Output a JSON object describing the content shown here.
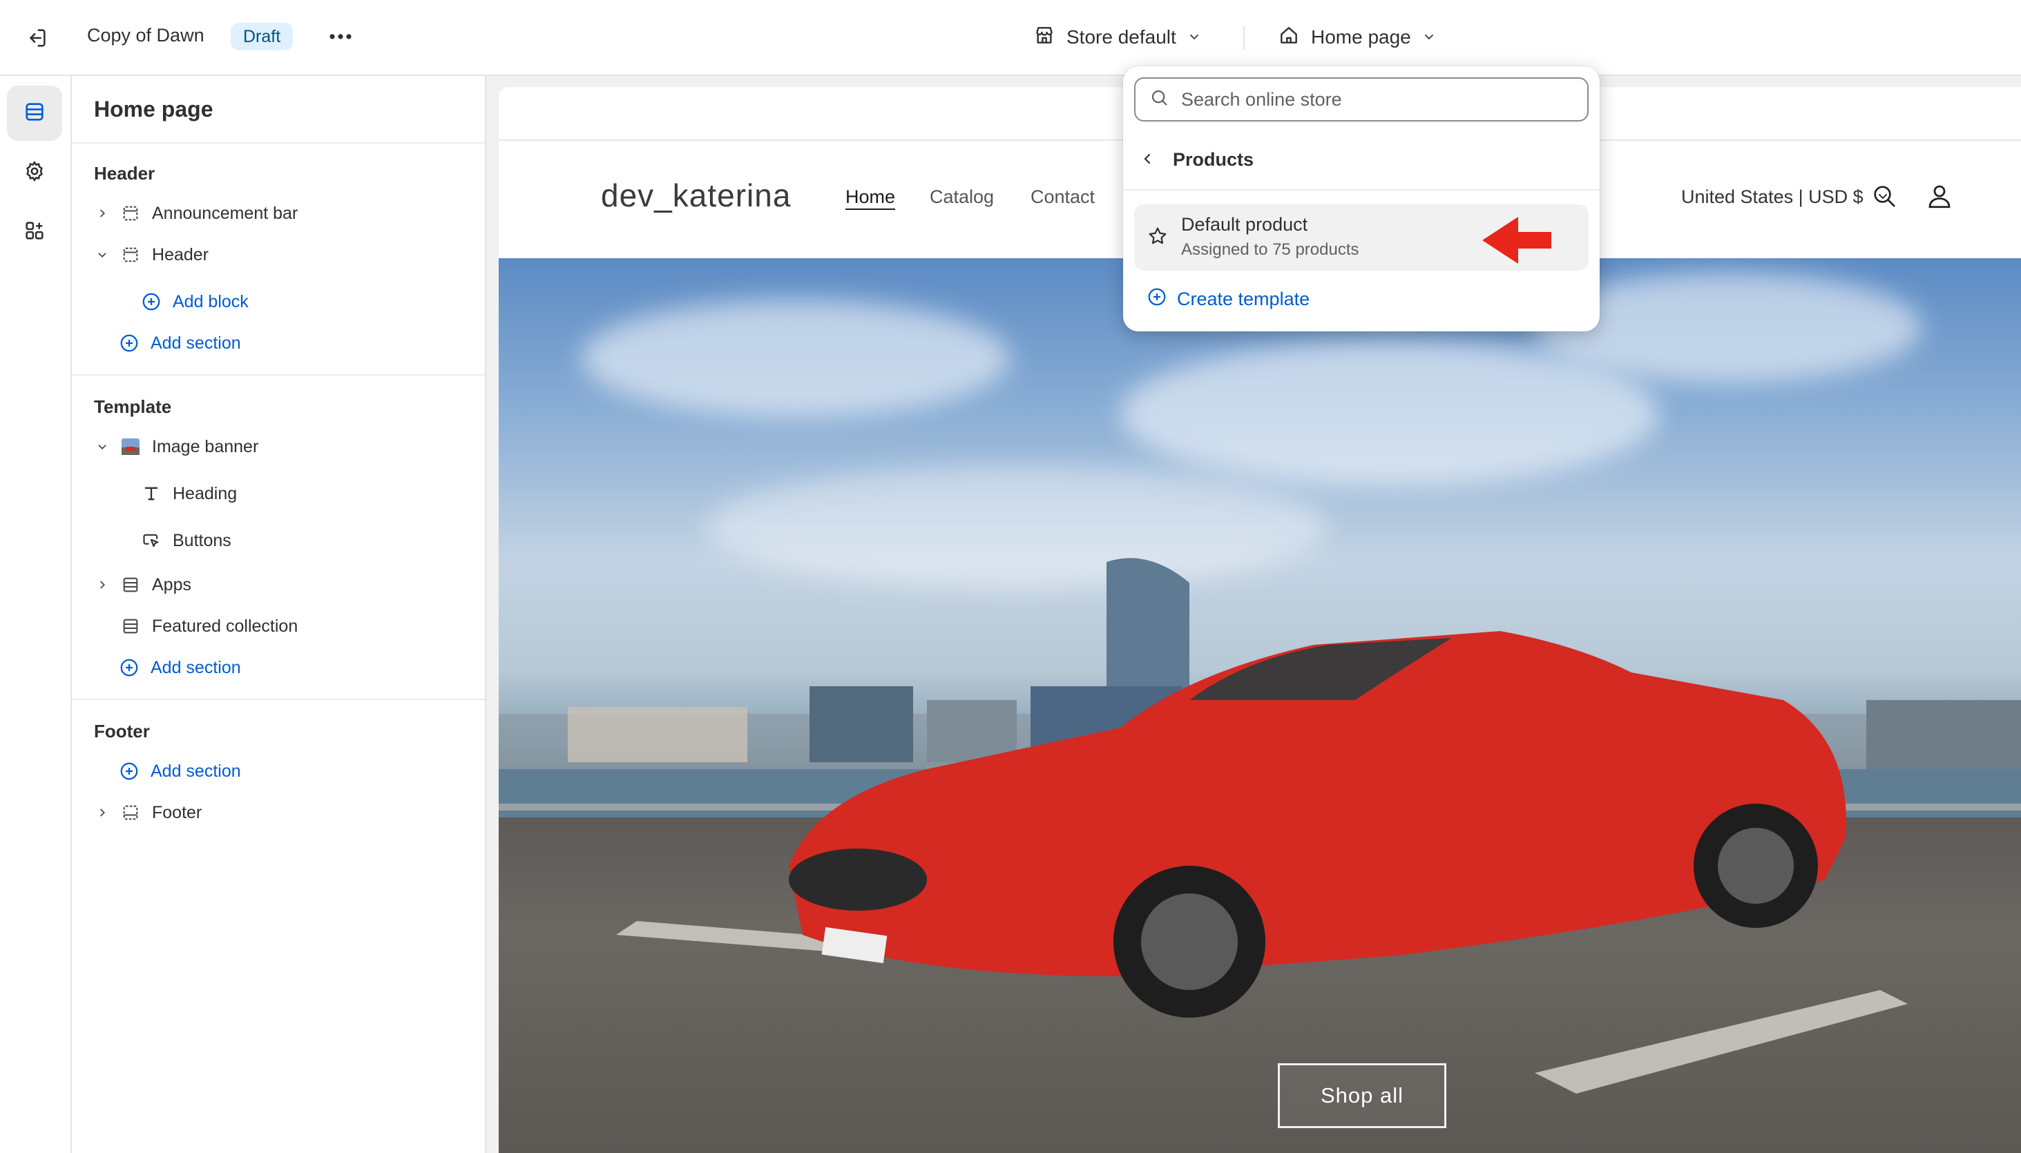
{
  "topbar": {
    "theme_name": "Copy of Dawn",
    "badge": "Draft",
    "store_context": "Store default",
    "page_context": "Home page"
  },
  "sidebar": {
    "title": "Home page",
    "header_group": {
      "title": "Header",
      "items": [
        {
          "label": "Announcement bar"
        },
        {
          "label": "Header"
        },
        {
          "label": "Add block"
        },
        {
          "label": "Add section"
        }
      ]
    },
    "template_group": {
      "title": "Template",
      "items": [
        {
          "label": "Image banner"
        },
        {
          "label": "Heading"
        },
        {
          "label": "Buttons"
        },
        {
          "label": "Apps"
        },
        {
          "label": "Featured collection"
        },
        {
          "label": "Add section"
        }
      ]
    },
    "footer_group": {
      "title": "Footer",
      "items": [
        {
          "label": "Add section"
        },
        {
          "label": "Footer"
        }
      ]
    }
  },
  "preview": {
    "store_name": "dev_katerina",
    "nav": [
      "Home",
      "Catalog",
      "Contact"
    ],
    "country": "United States | USD $",
    "banner_button": "Shop all"
  },
  "dropdown": {
    "search_placeholder": "Search online store",
    "back_label": "Products",
    "item": {
      "name": "Default product",
      "subtitle": "Assigned to 75 products"
    },
    "create_label": "Create template"
  },
  "colors": {
    "link": "#005bd3",
    "badge_bg": "#e0f0ff",
    "arrow": "#e8261a"
  }
}
